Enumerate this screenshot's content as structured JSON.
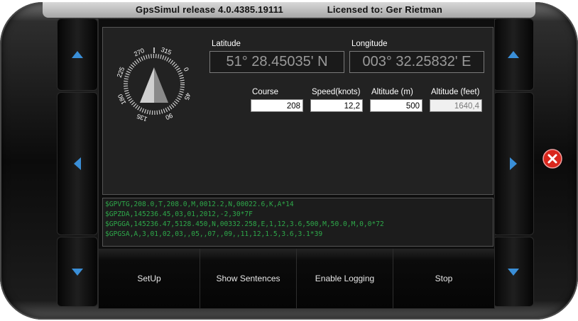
{
  "window": {
    "title": "GpsSimul release 4.0.4385.19111",
    "license": "Licensed to: Ger Rietman"
  },
  "colors": {
    "log_text": "#2ea84a",
    "arrow_blue": "#3a8fd8",
    "close_red": "#d9261c"
  },
  "compass": {
    "course_deg": 208,
    "labels": [
      "225",
      "270",
      "315",
      "0",
      "45",
      "90",
      "135",
      "180"
    ]
  },
  "position": {
    "latitude_label": "Latitude",
    "latitude_value": "51° 28.45035' N",
    "longitude_label": "Longitude",
    "longitude_value": "003° 32.25832' E"
  },
  "motion": {
    "course_label": "Course",
    "course_value": "208",
    "speed_label": "Speed(knots)",
    "speed_value": "12,2",
    "altitude_m_label": "Altitude (m)",
    "altitude_m_value": "500",
    "altitude_ft_label": "Altitude (feet)",
    "altitude_ft_value": "1640,4"
  },
  "sentences": [
    "$GPVTG,208.0,T,208.0,M,0012.2,N,00022.6,K,A*14",
    "$GPZDA,145236.45,03,01,2012,-2,30*7F",
    "$GPGGA,145236.47,5128.450,N,00332.258,E,1,12,3.6,500,M,50.0,M,0,0*72",
    "$GPGSA,A,3,01,02,03,,05,,07,,09,,11,12,1.5,3.6,3.1*39"
  ],
  "buttons": {
    "setup": "SetUp",
    "show_sentences": "Show Sentences",
    "enable_logging": "Enable Logging",
    "stop": "Stop"
  },
  "icons": {
    "up": "arrow-up-icon",
    "left": "arrow-left-icon",
    "right": "arrow-right-icon",
    "down": "arrow-down-icon",
    "close": "close-icon"
  }
}
